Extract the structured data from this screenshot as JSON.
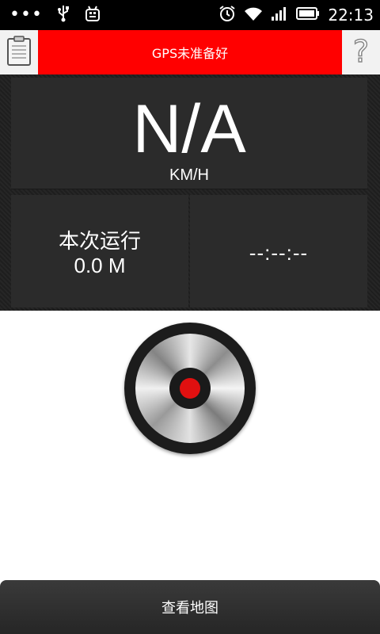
{
  "status_bar": {
    "time": "22:13",
    "icons": [
      "more-dots-icon",
      "usb-icon",
      "android-debug-icon",
      "alarm-icon",
      "wifi-icon",
      "signal-icon",
      "battery-icon"
    ]
  },
  "header": {
    "gps_status": "GPS未准备好",
    "banner_color": "#ff0000",
    "help_symbol": "?"
  },
  "speed": {
    "value": "N/A",
    "unit": "KM/H"
  },
  "run": {
    "label": "本次运行",
    "distance": "0.0 M",
    "time": "--:--:--"
  },
  "record_button": {
    "accent_color": "#e01010"
  },
  "footer": {
    "map_label": "查看地图"
  }
}
